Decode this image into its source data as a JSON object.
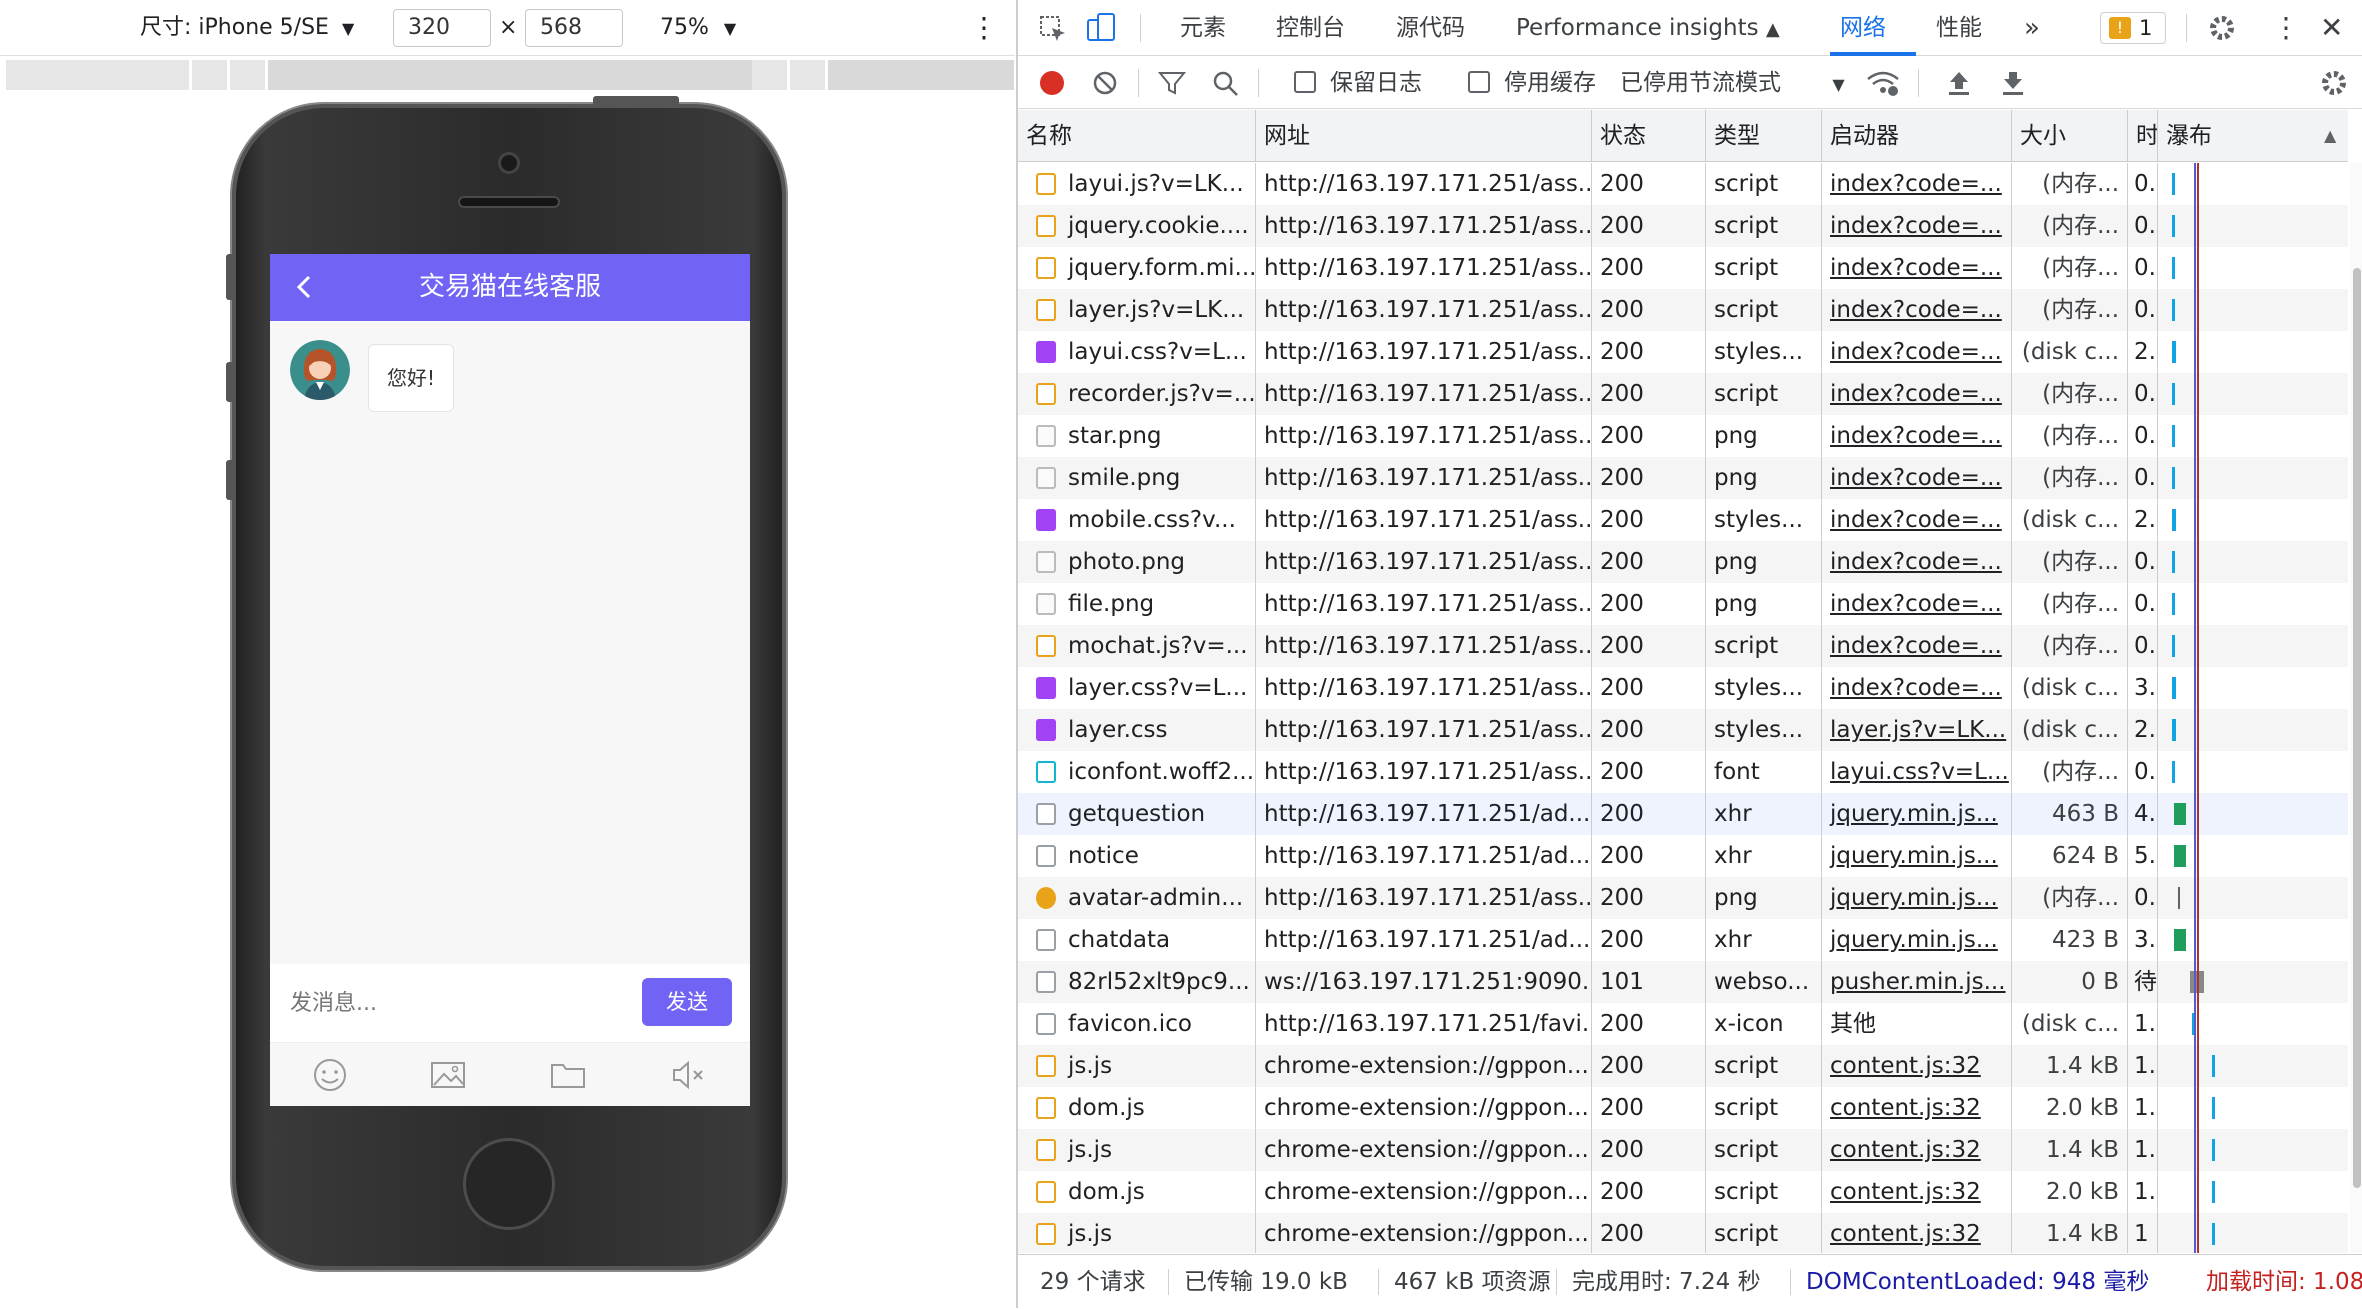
{
  "device_toolbar": {
    "dimensions_label": "尺寸: iPhone 5/SE",
    "width": "320",
    "times": "×",
    "height": "568",
    "zoom": "75%"
  },
  "phone_app": {
    "title": "交易猫在线客服",
    "greeting": "您好!",
    "input_placeholder": "发消息...",
    "send_label": "发送",
    "accent_color": "#7164f5"
  },
  "devtools": {
    "tabs": [
      "元素",
      "控制台",
      "源代码",
      "Performance insights",
      "网络",
      "性能"
    ],
    "active_tab": "网络",
    "issues_count": "1",
    "preserve_log": "保留日志",
    "disable_cache": "停用缓存",
    "throttling": "已停用节流模式"
  },
  "network": {
    "columns": [
      "名称",
      "网址",
      "状态",
      "类型",
      "启动器",
      "大小",
      "时",
      "瀑布"
    ],
    "rows": [
      {
        "name": "layui.js?v=LK...",
        "url": "http://163.197.171.251/ass...",
        "status": "200",
        "type": "script",
        "initiator": "index?code=...",
        "size": "(内存...",
        "time": "0...",
        "icon": "script"
      },
      {
        "name": "jquery.cookie....",
        "url": "http://163.197.171.251/ass...",
        "status": "200",
        "type": "script",
        "initiator": "index?code=...",
        "size": "(内存...",
        "time": "0...",
        "icon": "script"
      },
      {
        "name": "jquery.form.mi...",
        "url": "http://163.197.171.251/ass...",
        "status": "200",
        "type": "script",
        "initiator": "index?code=...",
        "size": "(内存...",
        "time": "0...",
        "icon": "script"
      },
      {
        "name": "layer.js?v=LK...",
        "url": "http://163.197.171.251/ass...",
        "status": "200",
        "type": "script",
        "initiator": "index?code=...",
        "size": "(内存...",
        "time": "0...",
        "icon": "script"
      },
      {
        "name": "layui.css?v=L...",
        "url": "http://163.197.171.251/ass...",
        "status": "200",
        "type": "styles...",
        "initiator": "index?code=...",
        "size": "(disk c...",
        "time": "2...",
        "icon": "style"
      },
      {
        "name": "recorder.js?v=...",
        "url": "http://163.197.171.251/ass...",
        "status": "200",
        "type": "script",
        "initiator": "index?code=...",
        "size": "(内存...",
        "time": "0...",
        "icon": "script"
      },
      {
        "name": "star.png",
        "url": "http://163.197.171.251/ass...",
        "status": "200",
        "type": "png",
        "initiator": "index?code=...",
        "size": "(内存...",
        "time": "0...",
        "icon": "img"
      },
      {
        "name": "smile.png",
        "url": "http://163.197.171.251/ass...",
        "status": "200",
        "type": "png",
        "initiator": "index?code=...",
        "size": "(内存...",
        "time": "0...",
        "icon": "img"
      },
      {
        "name": "mobile.css?v...",
        "url": "http://163.197.171.251/ass...",
        "status": "200",
        "type": "styles...",
        "initiator": "index?code=...",
        "size": "(disk c...",
        "time": "2...",
        "icon": "style"
      },
      {
        "name": "photo.png",
        "url": "http://163.197.171.251/ass...",
        "status": "200",
        "type": "png",
        "initiator": "index?code=...",
        "size": "(内存...",
        "time": "0...",
        "icon": "img"
      },
      {
        "name": "file.png",
        "url": "http://163.197.171.251/ass...",
        "status": "200",
        "type": "png",
        "initiator": "index?code=...",
        "size": "(内存...",
        "time": "0...",
        "icon": "img"
      },
      {
        "name": "mochat.js?v=...",
        "url": "http://163.197.171.251/ass...",
        "status": "200",
        "type": "script",
        "initiator": "index?code=...",
        "size": "(内存...",
        "time": "0...",
        "icon": "script"
      },
      {
        "name": "layer.css?v=L...",
        "url": "http://163.197.171.251/ass...",
        "status": "200",
        "type": "styles...",
        "initiator": "index?code=...",
        "size": "(disk c...",
        "time": "3...",
        "icon": "style"
      },
      {
        "name": "layer.css",
        "url": "http://163.197.171.251/ass...",
        "status": "200",
        "type": "styles...",
        "initiator": "layer.js?v=LK...",
        "size": "(disk c...",
        "time": "2...",
        "icon": "style"
      },
      {
        "name": "iconfont.woff2...",
        "url": "http://163.197.171.251/ass...",
        "status": "200",
        "type": "font",
        "initiator": "layui.css?v=L...",
        "size": "(内存...",
        "time": "0...",
        "icon": "font"
      },
      {
        "name": "getquestion",
        "url": "http://163.197.171.251/ad...",
        "status": "200",
        "type": "xhr",
        "initiator": "jquery.min.js...",
        "size": "463 B",
        "time": "4...",
        "icon": "doc"
      },
      {
        "name": "notice",
        "url": "http://163.197.171.251/ad...",
        "status": "200",
        "type": "xhr",
        "initiator": "jquery.min.js...",
        "size": "624 B",
        "time": "5...",
        "icon": "doc"
      },
      {
        "name": "avatar-admin...",
        "url": "http://163.197.171.251/ass...",
        "status": "200",
        "type": "png",
        "initiator": "jquery.min.js...",
        "size": "(内存...",
        "time": "0...",
        "icon": "avatar"
      },
      {
        "name": "chatdata",
        "url": "http://163.197.171.251/ad...",
        "status": "200",
        "type": "xhr",
        "initiator": "jquery.min.js...",
        "size": "423 B",
        "time": "3...",
        "icon": "doc"
      },
      {
        "name": "82rl52xlt9pc9...",
        "url": "ws://163.197.171.251:9090...",
        "status": "101",
        "type": "webso...",
        "initiator": "pusher.min.js...",
        "size": "0 B",
        "time": "待",
        "icon": "doc"
      },
      {
        "name": "favicon.ico",
        "url": "http://163.197.171.251/favi...",
        "status": "200",
        "type": "x-icon",
        "initiator": "其他",
        "size": "(disk c...",
        "time": "1...",
        "icon": "doc"
      },
      {
        "name": "js.js",
        "url": "chrome-extension://gppon...",
        "status": "200",
        "type": "script",
        "initiator": "content.js:32",
        "size": "1.4 kB",
        "time": "1...",
        "icon": "script"
      },
      {
        "name": "dom.js",
        "url": "chrome-extension://gppon...",
        "status": "200",
        "type": "script",
        "initiator": "content.js:32",
        "size": "2.0 kB",
        "time": "1...",
        "icon": "script"
      },
      {
        "name": "js.js",
        "url": "chrome-extension://gppon...",
        "status": "200",
        "type": "script",
        "initiator": "content.js:32",
        "size": "1.4 kB",
        "time": "1...",
        "icon": "script"
      },
      {
        "name": "dom.js",
        "url": "chrome-extension://gppon...",
        "status": "200",
        "type": "script",
        "initiator": "content.js:32",
        "size": "2.0 kB",
        "time": "1...",
        "icon": "script"
      },
      {
        "name": "js.js",
        "url": "chrome-extension://gppon...",
        "status": "200",
        "type": "script",
        "initiator": "content.js:32",
        "size": "1.4 kB",
        "time": "1",
        "icon": "script"
      }
    ]
  },
  "status_bar": {
    "requests": "29 个请求",
    "transferred": "已传输 19.0 kB",
    "resources": "467 kB 项资源",
    "finish": "完成用时: 7.24 秒",
    "dcl": "DOMContentLoaded: 948 毫秒",
    "load": "加载时间: 1.08"
  }
}
